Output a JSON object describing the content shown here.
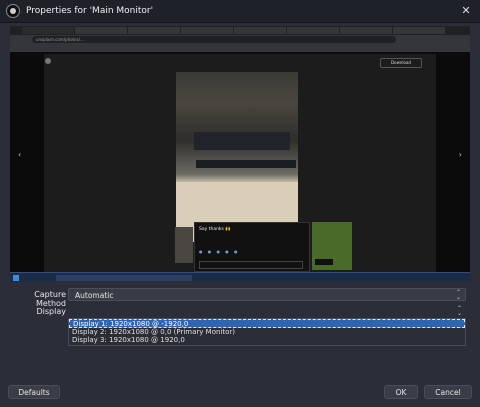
{
  "window": {
    "title": "Properties for 'Main Monitor'",
    "close_glyph": "✕"
  },
  "preview": {
    "tabs": [
      "",
      "",
      "",
      "",
      "",
      "",
      "",
      "",
      ""
    ],
    "url": "unsplash.com/photos/...",
    "bookmarks": "",
    "author_name": "",
    "download_label": "Download",
    "stats": [
      "",
      "",
      ""
    ],
    "popup": {
      "title": "Say thanks 🙌",
      "body": "",
      "field": ""
    },
    "sidecard": {
      "heading": "",
      "body": "",
      "cta": ""
    },
    "share": "",
    "taskbar_tasks": [
      "",
      "",
      "",
      ""
    ],
    "clock": ""
  },
  "form": {
    "capture_method_label": "Capture Method",
    "capture_method_value": "Automatic",
    "display_label": "Display",
    "display_value": "Display 1: 1920x1080 @ -1920,0",
    "display_options": [
      "Display 1: 1920x1080 @ -1920,0",
      "Display 2: 1920x1080 @ 0,0 (Primary Monitor)",
      "Display 3: 1920x1080 @ 1920,0"
    ],
    "selected_index": 0
  },
  "buttons": {
    "defaults": "Defaults",
    "ok": "OK",
    "cancel": "Cancel"
  },
  "colors": {
    "accent": "#2d65b0",
    "background": "#2b2e38"
  }
}
